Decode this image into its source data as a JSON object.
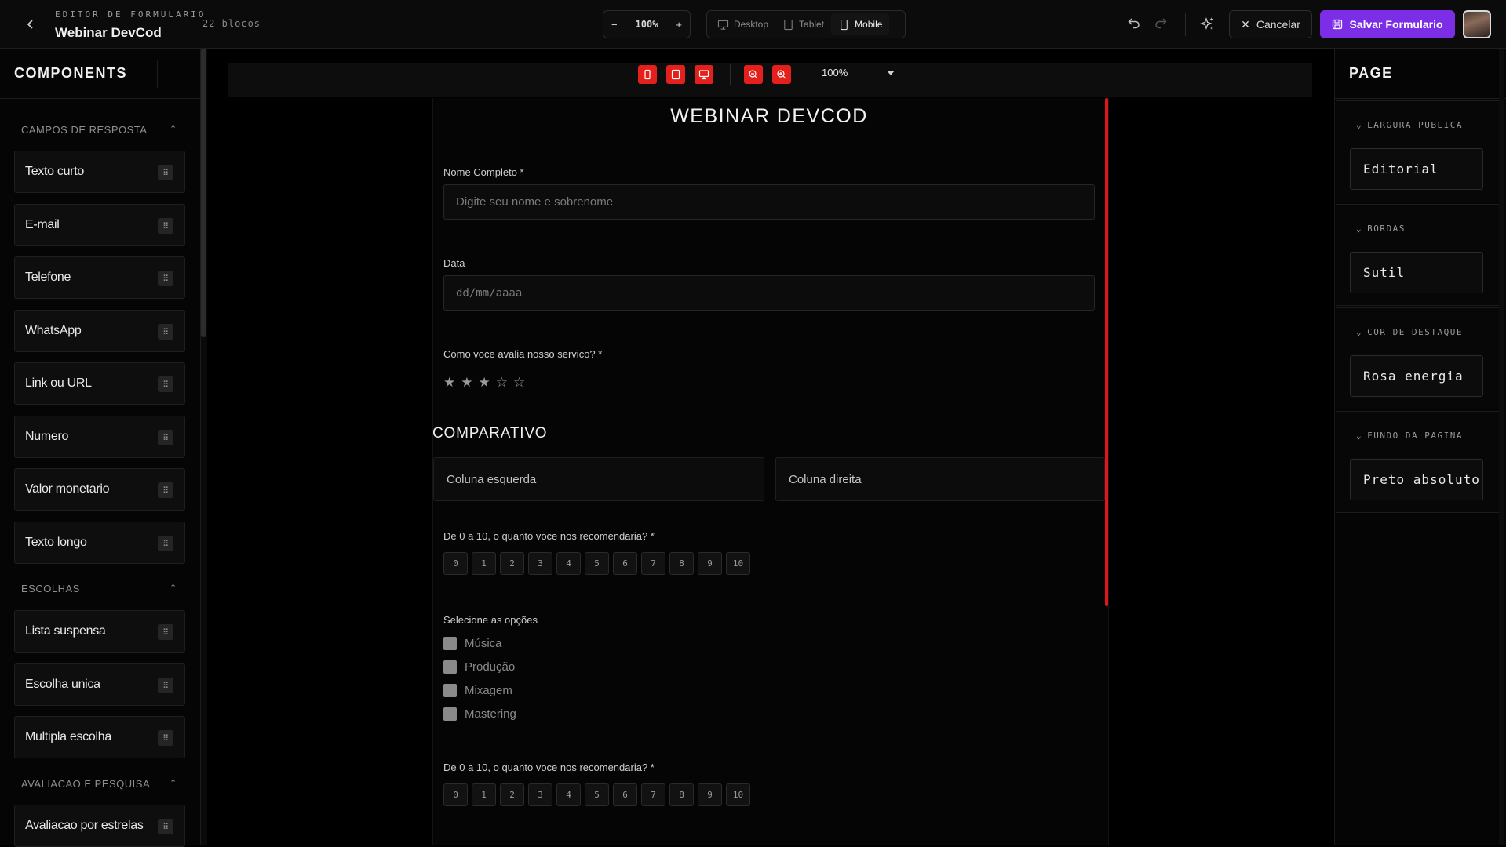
{
  "header": {
    "editor_label": "EDITOR DE FORMULARIO",
    "form_name": "Webinar DevCod",
    "blocks_count": "22 blocos",
    "zoom": "100%",
    "devices": [
      "Desktop",
      "Tablet",
      "Mobile"
    ],
    "active_device": "Mobile",
    "cancel_label": "Cancelar",
    "save_label": "Salvar Formulario"
  },
  "sidebar": {
    "title": "COMPONENTS",
    "sections": [
      {
        "label": "CAMPOS DE RESPOSTA",
        "items": [
          "Texto curto",
          "E-mail",
          "Telefone",
          "WhatsApp",
          "Link ou URL",
          "Numero",
          "Valor monetario",
          "Texto longo"
        ]
      },
      {
        "label": "ESCOLHAS",
        "items": [
          "Lista suspensa",
          "Escolha unica",
          "Multipla escolha"
        ]
      },
      {
        "label": "AVALIACAO E PESQUISA",
        "items": [
          "Avaliacao por estrelas"
        ]
      }
    ]
  },
  "canvas": {
    "zoom": "100%",
    "form": {
      "title": "WEBINAR DEVCOD",
      "full_name_label": "Nome Completo *",
      "full_name_placeholder": "Digite seu nome e sobrenome",
      "date_label": "Data",
      "date_placeholder": "dd/mm/aaaa",
      "rating_label": "Como voce avalia nosso servico? *",
      "rating_value": 3,
      "rating_max": 5,
      "section_title": "COMPARATIVO",
      "left_column": "Coluna esquerda",
      "right_column": "Coluna direita",
      "nps_label_1": "De 0 a 10, o quanto voce nos recomendaria? *",
      "nps_scale": [
        "0",
        "1",
        "2",
        "3",
        "4",
        "5",
        "6",
        "7",
        "8",
        "9",
        "10"
      ],
      "options_label": "Selecione as opções",
      "options": [
        "Música",
        "Produção",
        "Mixagem",
        "Mastering"
      ],
      "nps_label_2": "De 0 a 10, o quanto voce nos recomendaria? *"
    }
  },
  "page_panel": {
    "title": "PAGE",
    "props": [
      {
        "label": "LARGURA PUBLICA",
        "value": "Editorial"
      },
      {
        "label": "BORDAS",
        "value": "Sutil"
      },
      {
        "label": "COR DE DESTAQUE",
        "value": "Rosa energia"
      },
      {
        "label": "FUNDO DA PAGINA",
        "value": "Preto absoluto"
      }
    ]
  },
  "colors": {
    "accent": "#7c2ee6",
    "danger": "#e4201d"
  }
}
